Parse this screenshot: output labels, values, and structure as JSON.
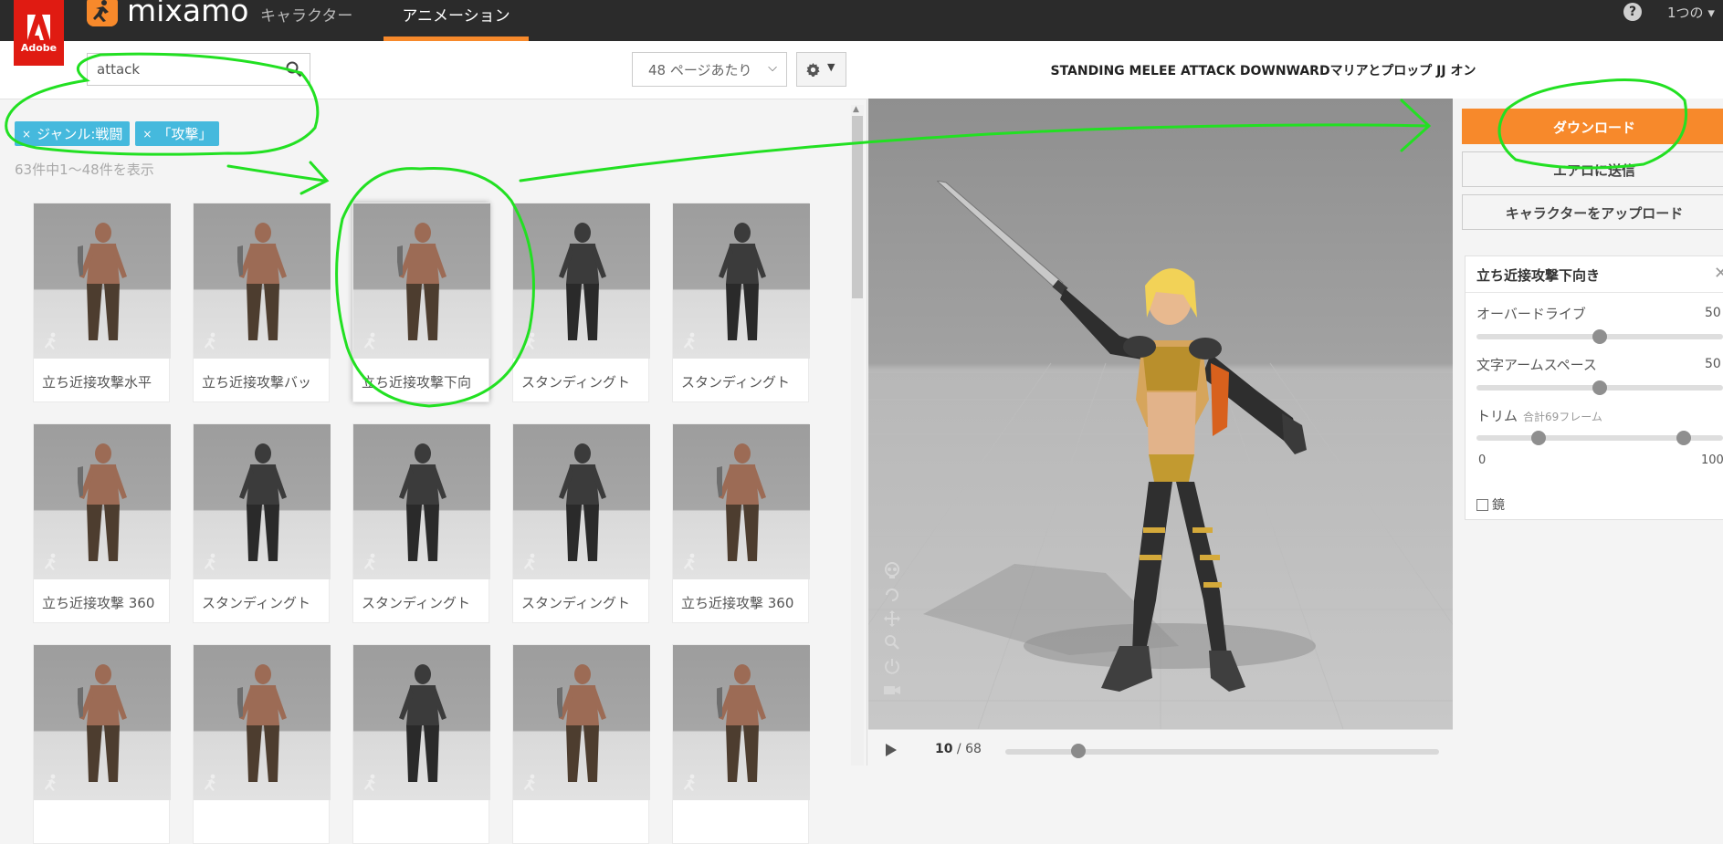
{
  "topbar": {
    "adobe_text": "Adobe",
    "brand": "mixamo",
    "nav": [
      {
        "label": "キャラクター",
        "active": false
      },
      {
        "label": "アニメーション",
        "active": true
      }
    ],
    "help": "?",
    "account": "1つの"
  },
  "search": {
    "value": "attack",
    "per_page": "48 ページあたり"
  },
  "filters": {
    "tags": [
      "ジャンル:戦闘",
      "「攻撃」"
    ],
    "results_text": "63件中1〜48件を表示"
  },
  "grid": {
    "cards": [
      {
        "label": "立ち近接攻撃水平",
        "kind": "brute"
      },
      {
        "label": "立ち近接攻撃バッ",
        "kind": "brute"
      },
      {
        "label": "立ち近接攻撃下向",
        "kind": "brute",
        "selected": true
      },
      {
        "label": "スタンディングト",
        "kind": "rogue"
      },
      {
        "label": "スタンディングト",
        "kind": "rogue"
      },
      {
        "label": "立ち近接攻撃 360",
        "kind": "brute"
      },
      {
        "label": "スタンディングト",
        "kind": "rogue"
      },
      {
        "label": "スタンディングト",
        "kind": "rogue"
      },
      {
        "label": "スタンディングト",
        "kind": "rogue"
      },
      {
        "label": "立ち近接攻撃 360",
        "kind": "brute"
      },
      {
        "label": "",
        "kind": "brute"
      },
      {
        "label": "",
        "kind": "brute"
      },
      {
        "label": "",
        "kind": "rogue"
      },
      {
        "label": "",
        "kind": "brute"
      },
      {
        "label": "",
        "kind": "brute"
      }
    ]
  },
  "preview": {
    "title": "STANDING MELEE ATTACK DOWNWARDマリアとプロップ JJ オン",
    "frame_current": "10",
    "frame_total": "68"
  },
  "actions": {
    "download": "ダウンロード",
    "send_aero": "エアロに送信",
    "upload_character": "キャラクターをアップロード"
  },
  "settings": {
    "title": "立ち近接攻撃下向き",
    "overdrive_label": "オーバードライブ",
    "overdrive_value": "50",
    "overdrive_level": 0.5,
    "armspace_label": "文字アームスペース",
    "armspace_value": "50",
    "armspace_level": 0.5,
    "trim_label": "トリム",
    "trim_note": "合計69フレーム",
    "trim_min": "0",
    "trim_max": "100",
    "trim_start": 0.25,
    "trim_end": 0.84,
    "mirror_label": "鏡"
  },
  "colors": {
    "accent": "#f7892b",
    "tag": "#45b9dd",
    "annotation": "#22e022"
  }
}
